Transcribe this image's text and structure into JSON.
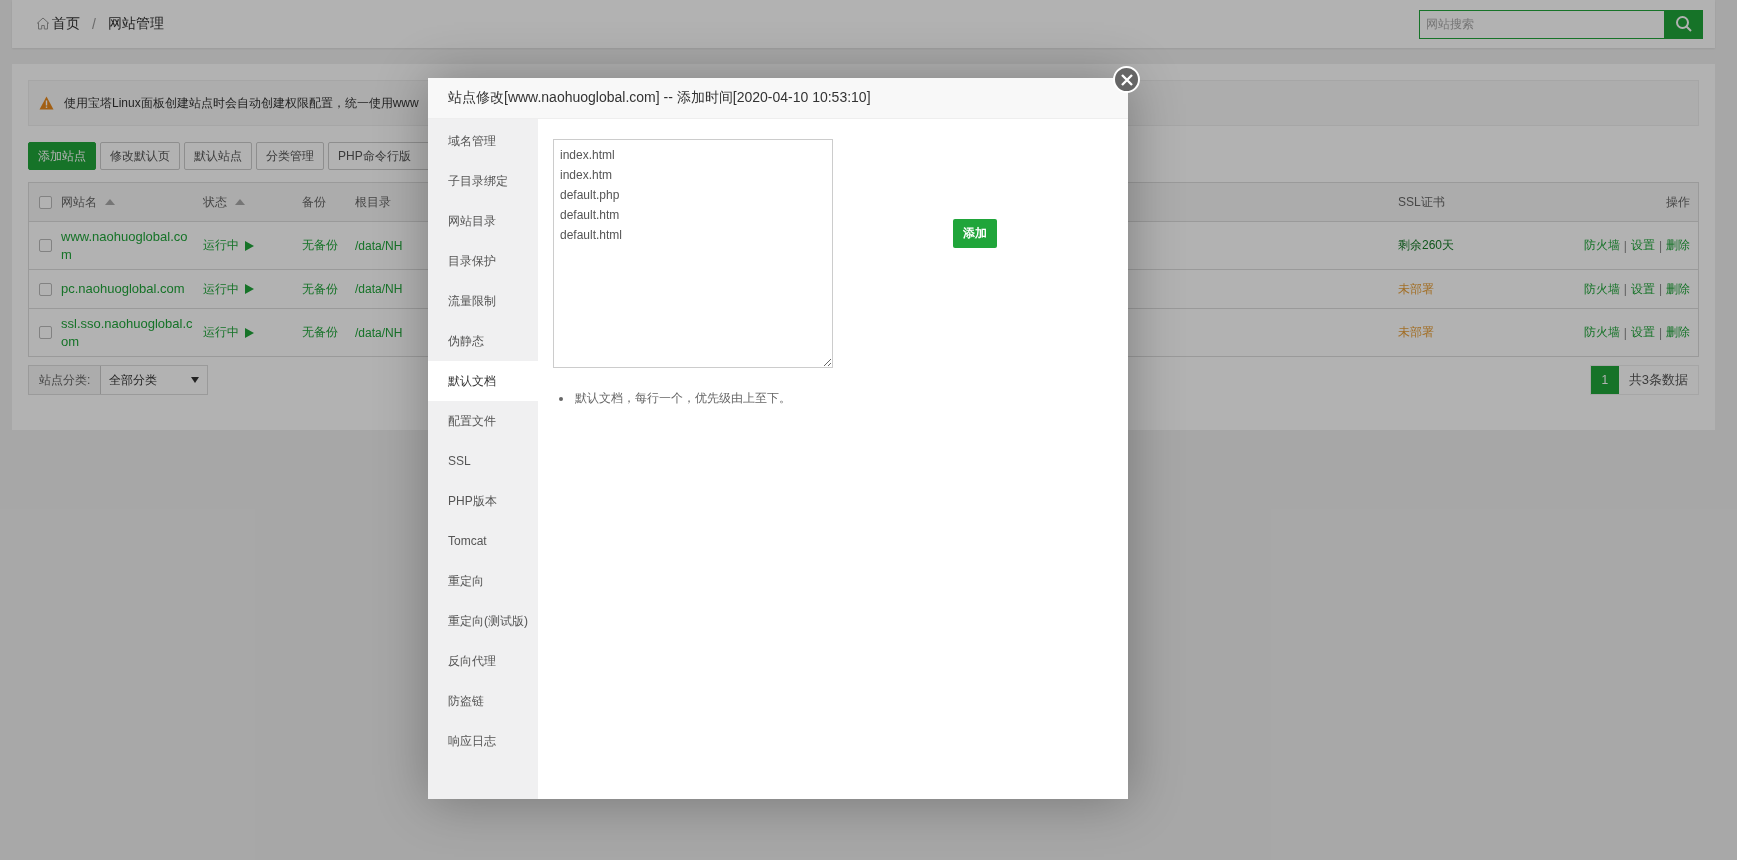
{
  "breadcrumb": [
    {
      "label": "首页",
      "kind": "home"
    },
    {
      "label": "/",
      "kind": "separator"
    },
    {
      "label": "网站管理",
      "kind": "page"
    }
  ],
  "search": {
    "placeholder": "网站搜索"
  },
  "notice": {
    "text": "使用宝塔Linux面板创建站点时会自动创建权限配置，统一使用www"
  },
  "toolbar": [
    {
      "label": "添加站点",
      "primary": true
    },
    {
      "label": "修改默认页",
      "primary": false
    },
    {
      "label": "默认站点",
      "primary": false
    },
    {
      "label": "分类管理",
      "primary": false
    },
    {
      "label": "PHP命令行版",
      "primary": false
    }
  ],
  "table": {
    "header_checkbox": {
      "checked": false
    },
    "columns": [
      {
        "label": "网站名",
        "sortable": true
      },
      {
        "label": "状态",
        "sortable": true
      },
      {
        "label": "备份",
        "sortable": false
      },
      {
        "label": "根目录",
        "sortable": false
      },
      {
        "label": "SSL证书",
        "sortable": false
      },
      {
        "label": "操作",
        "sortable": false
      }
    ],
    "rows": [
      {
        "checked": false,
        "name": "www.naohuoglobal.com",
        "status": "运行中",
        "backup": "无备份",
        "root": "/data/NH",
        "ssl": "剩余260天",
        "ssl_deployed": true,
        "actions": [
          {
            "kind": "link",
            "label": "防火墙"
          },
          {
            "kind": "separator",
            "label": "|"
          },
          {
            "kind": "link",
            "label": "设置"
          },
          {
            "kind": "separator",
            "label": "|"
          },
          {
            "kind": "link",
            "label": "删除"
          }
        ]
      },
      {
        "checked": false,
        "name": "pc.naohuoglobal.com",
        "status": "运行中",
        "backup": "无备份",
        "root": "/data/NH",
        "ssl": "未部署",
        "ssl_deployed": false,
        "actions": [
          {
            "kind": "link",
            "label": "防火墙"
          },
          {
            "kind": "separator",
            "label": "|"
          },
          {
            "kind": "link",
            "label": "设置"
          },
          {
            "kind": "separator",
            "label": "|"
          },
          {
            "kind": "link",
            "label": "删除"
          }
        ]
      },
      {
        "checked": false,
        "name": "ssl.sso.naohuoglobal.com",
        "status": "运行中",
        "backup": "无备份",
        "root": "/data/NH",
        "ssl": "未部署",
        "ssl_deployed": false,
        "actions": [
          {
            "kind": "link",
            "label": "防火墙"
          },
          {
            "kind": "separator",
            "label": "|"
          },
          {
            "kind": "link",
            "label": "设置"
          },
          {
            "kind": "separator",
            "label": "|"
          },
          {
            "kind": "link",
            "label": "删除"
          }
        ]
      }
    ]
  },
  "footer": {
    "category_label": "站点分类:",
    "category_value": "全部分类",
    "pages": [
      {
        "label": "1",
        "selected": true
      }
    ],
    "total": "共3条数据"
  },
  "modal": {
    "title": "站点修改[www.naohuoglobal.com] -- 添加时间[2020-04-10 10:53:10]",
    "tabs": [
      {
        "label": "域名管理",
        "selected": false
      },
      {
        "label": "子目录绑定",
        "selected": false
      },
      {
        "label": "网站目录",
        "selected": false
      },
      {
        "label": "目录保护",
        "selected": false
      },
      {
        "label": "流量限制",
        "selected": false
      },
      {
        "label": "伪静态",
        "selected": false
      },
      {
        "label": "默认文档",
        "selected": true
      },
      {
        "label": "配置文件",
        "selected": false
      },
      {
        "label": "SSL",
        "selected": false
      },
      {
        "label": "PHP版本",
        "selected": false
      },
      {
        "label": "Tomcat",
        "selected": false
      },
      {
        "label": "重定向",
        "selected": false
      },
      {
        "label": "重定向(测试版)",
        "selected": false
      },
      {
        "label": "反向代理",
        "selected": false
      },
      {
        "label": "防盗链",
        "selected": false
      },
      {
        "label": "响应日志",
        "selected": false
      }
    ],
    "documents": [
      "index.html",
      "index.htm",
      "default.php",
      "default.htm",
      "default.html"
    ],
    "add_button": "添加",
    "note": "默认文档，每行一个，优先级由上至下。"
  }
}
